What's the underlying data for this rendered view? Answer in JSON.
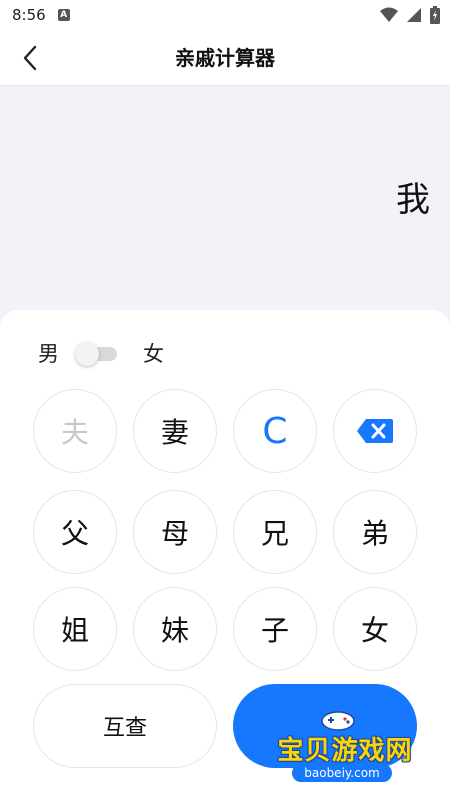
{
  "status_bar": {
    "time": "8:56",
    "notification_letter": "A"
  },
  "app_bar": {
    "title": "亲戚计算器"
  },
  "display": {
    "value": "我"
  },
  "gender": {
    "male_label": "男",
    "female_label": "女"
  },
  "keys": {
    "husband": "夫",
    "wife": "妻",
    "clear": "C",
    "father": "父",
    "mother": "母",
    "elder_brother": "兄",
    "younger_brother": "弟",
    "elder_sister": "姐",
    "younger_sister": "妹",
    "son": "子",
    "daughter": "女",
    "mutual_check": "互查"
  },
  "watermark": {
    "title": "宝贝游戏网",
    "url": "baobeiy.com"
  },
  "colors": {
    "accent": "#1677ff",
    "background": "#f2f3f8",
    "key_border": "#e6e6e9",
    "disabled_text": "#c9c9cc"
  }
}
